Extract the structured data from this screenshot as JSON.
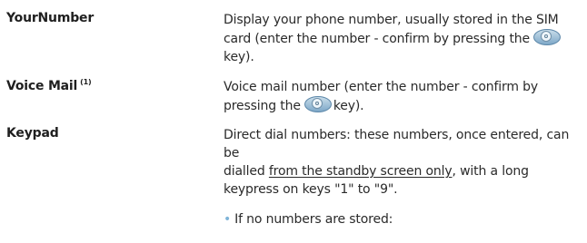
{
  "entries": [
    {
      "term": "YourNumber",
      "lines": [
        "Display your phone number, usually stored in the SIM",
        "card (enter the number - confirm by pressing the",
        "key)."
      ]
    },
    {
      "term": "Voice Mail",
      "superscript": "(1)",
      "lines": [
        "Voice mail number (enter the number - confirm by",
        "pressing the",
        "key)."
      ]
    },
    {
      "term": "Keypad",
      "lines": [
        "Direct dial numbers: these numbers, once entered, can be",
        "dialled",
        "from the standby screen only",
        ", with a long",
        "keypress on keys \"1\" to \"9\"."
      ],
      "bullet": {
        "marker": "•",
        "text": "If no numbers are stored:"
      }
    }
  ],
  "icon": {
    "name": "ok-key-icon",
    "colors": [
      "#7ea8c8",
      "#eef5fa"
    ]
  }
}
